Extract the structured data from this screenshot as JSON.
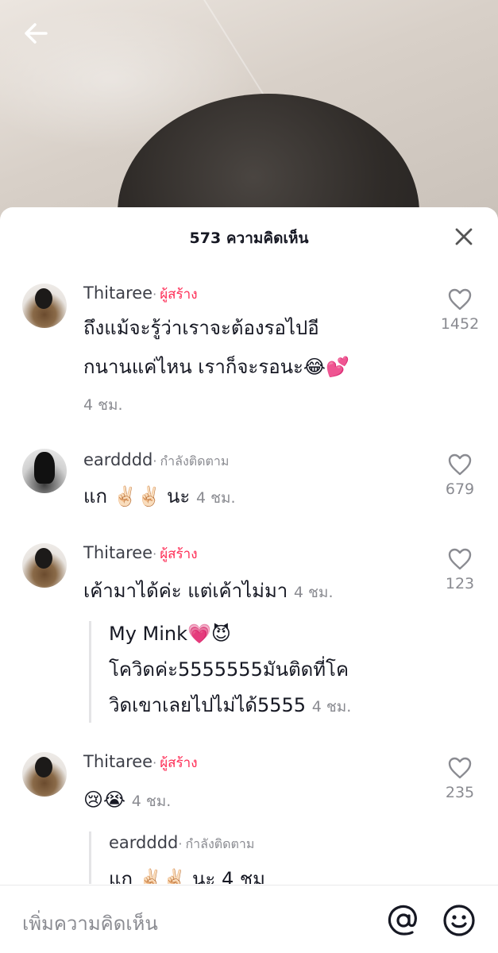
{
  "header": {
    "comment_count_title": "573 ความคิดเห็น"
  },
  "comments": [
    {
      "username": "Thitaree",
      "dot": "·",
      "badge": "ผู้สร้าง",
      "text_line1": "ถึงแม้จะรู้ว่าเราจะต้องรอไปอี",
      "text_line2": "กนานแค่ไหน เราก็จะรอนะ😂💕",
      "time": "4 ชม.",
      "likes": "1452"
    },
    {
      "username": "eardddd",
      "dot": "·",
      "badge": "กำลังติดตาม",
      "text": "แก ✌🏻✌🏻 นะ",
      "time": "4 ชม.",
      "likes": "679"
    },
    {
      "username": "Thitaree",
      "dot": "·",
      "badge": "ผู้สร้าง",
      "text": "เค้ามาได้ค่ะ แต่เค้าไม่มา",
      "time": "4 ชม.",
      "likes": "123"
    },
    {
      "username": "Thitaree",
      "dot": "·",
      "badge": "ผู้สร้าง",
      "text": "😢😭",
      "time": "4 ชม.",
      "likes": "235"
    }
  ],
  "quoted_reply": {
    "author": "My Mink💗😈",
    "line1": "โควิดค่ะ5555555มันติดที่โค",
    "line2": "วิดเขาเลยไปไม่ได้5555",
    "time": "4 ชม."
  },
  "quoted_reply_2": {
    "username": "eardddd",
    "dot": "·",
    "badge": "กำลังติดตาม",
    "text": "แก ✌🏻✌🏻 นะ 4 ชม"
  },
  "input": {
    "placeholder": "เพิ่มความคิดเห็น"
  },
  "icons": {
    "back": "arrow-left-icon",
    "close": "close-icon",
    "like": "heart-outline-icon",
    "mention": "at-sign-icon",
    "emoji": "smiley-icon"
  },
  "colors": {
    "creator_badge": "#fe2c55",
    "secondary_text": "#8a8b91"
  }
}
